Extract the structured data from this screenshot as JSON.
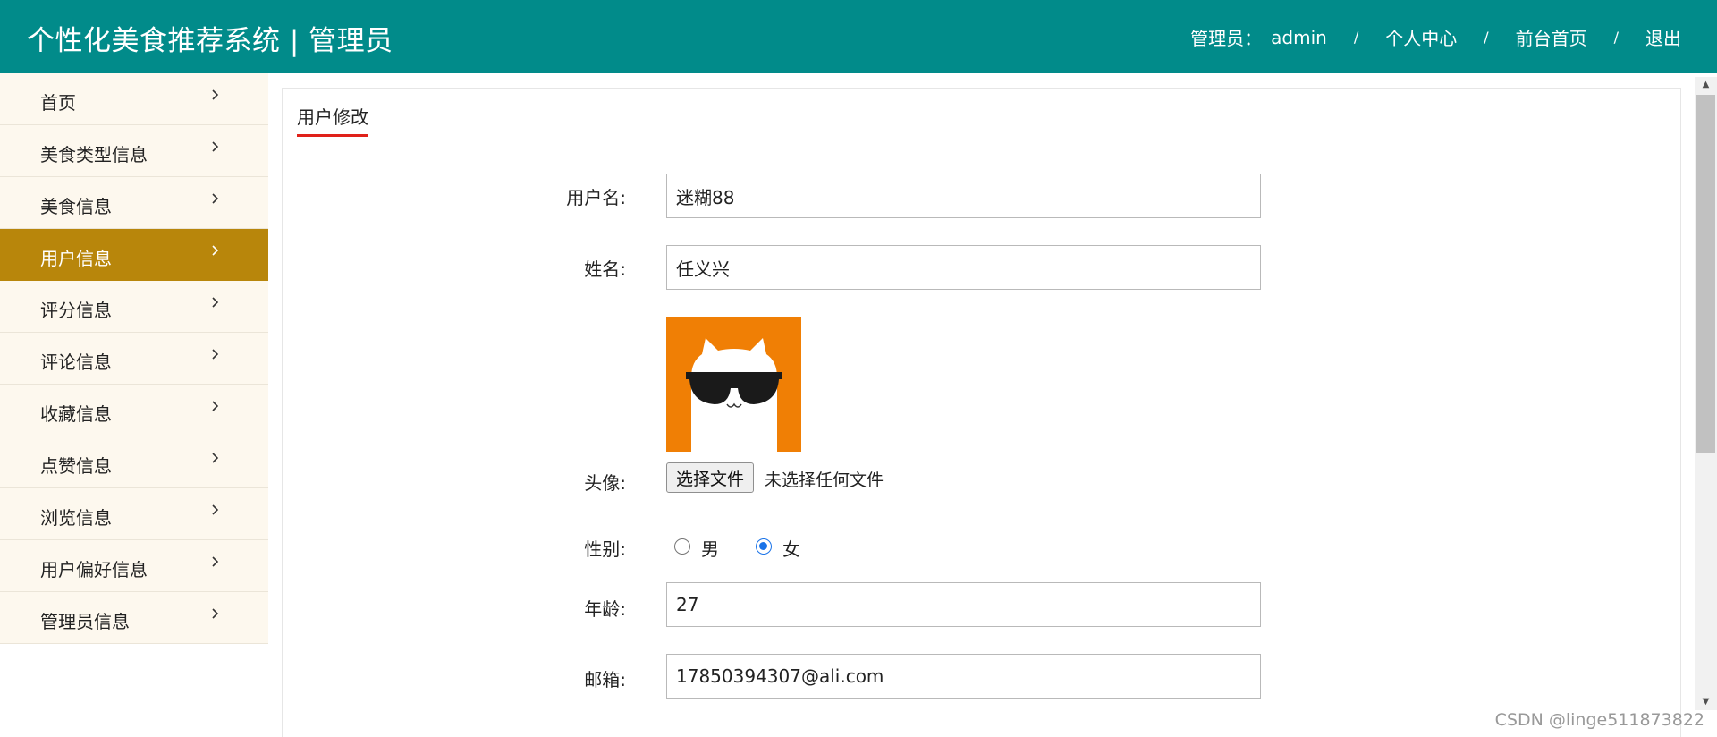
{
  "header": {
    "title": "个性化美食推荐系统 | 管理员",
    "admin_label": "管理员：",
    "admin_name": "admin",
    "separator": "/",
    "links": [
      "个人中心",
      "前台首页",
      "退出"
    ]
  },
  "sidebar": {
    "items": [
      {
        "label": "首页",
        "active": false
      },
      {
        "label": "美食类型信息",
        "active": false
      },
      {
        "label": "美食信息",
        "active": false
      },
      {
        "label": "用户信息",
        "active": true
      },
      {
        "label": "评分信息",
        "active": false
      },
      {
        "label": "评论信息",
        "active": false
      },
      {
        "label": "收藏信息",
        "active": false
      },
      {
        "label": "点赞信息",
        "active": false
      },
      {
        "label": "浏览信息",
        "active": false
      },
      {
        "label": "用户偏好信息",
        "active": false
      },
      {
        "label": "管理员信息",
        "active": false
      }
    ],
    "chevron_icon": "chevron-right-icon"
  },
  "main": {
    "tab_title": "用户修改",
    "form": {
      "username_label": "用户名:",
      "username_value": "迷糊88",
      "name_label": "姓名:",
      "name_value": "任义兴",
      "avatar_label": "头像:",
      "avatar_icon": "cat-with-sunglasses-avatar",
      "file_button": "选择文件",
      "file_status": "未选择任何文件",
      "gender_label": "性别:",
      "gender_options": [
        "男",
        "女"
      ],
      "gender_selected": "女",
      "age_label": "年龄:",
      "age_value": "27",
      "email_label": "邮箱:",
      "email_value": "17850394307@ali.com"
    }
  },
  "watermark": "CSDN @linge511873822",
  "colors": {
    "header_bg": "#018b8a",
    "sidebar_bg": "#fdf8ee",
    "active_bg": "#b8860b",
    "tab_underline": "#e0211a",
    "avatar_bg": "#f07f05",
    "radio_checked": "#1a73e8"
  }
}
